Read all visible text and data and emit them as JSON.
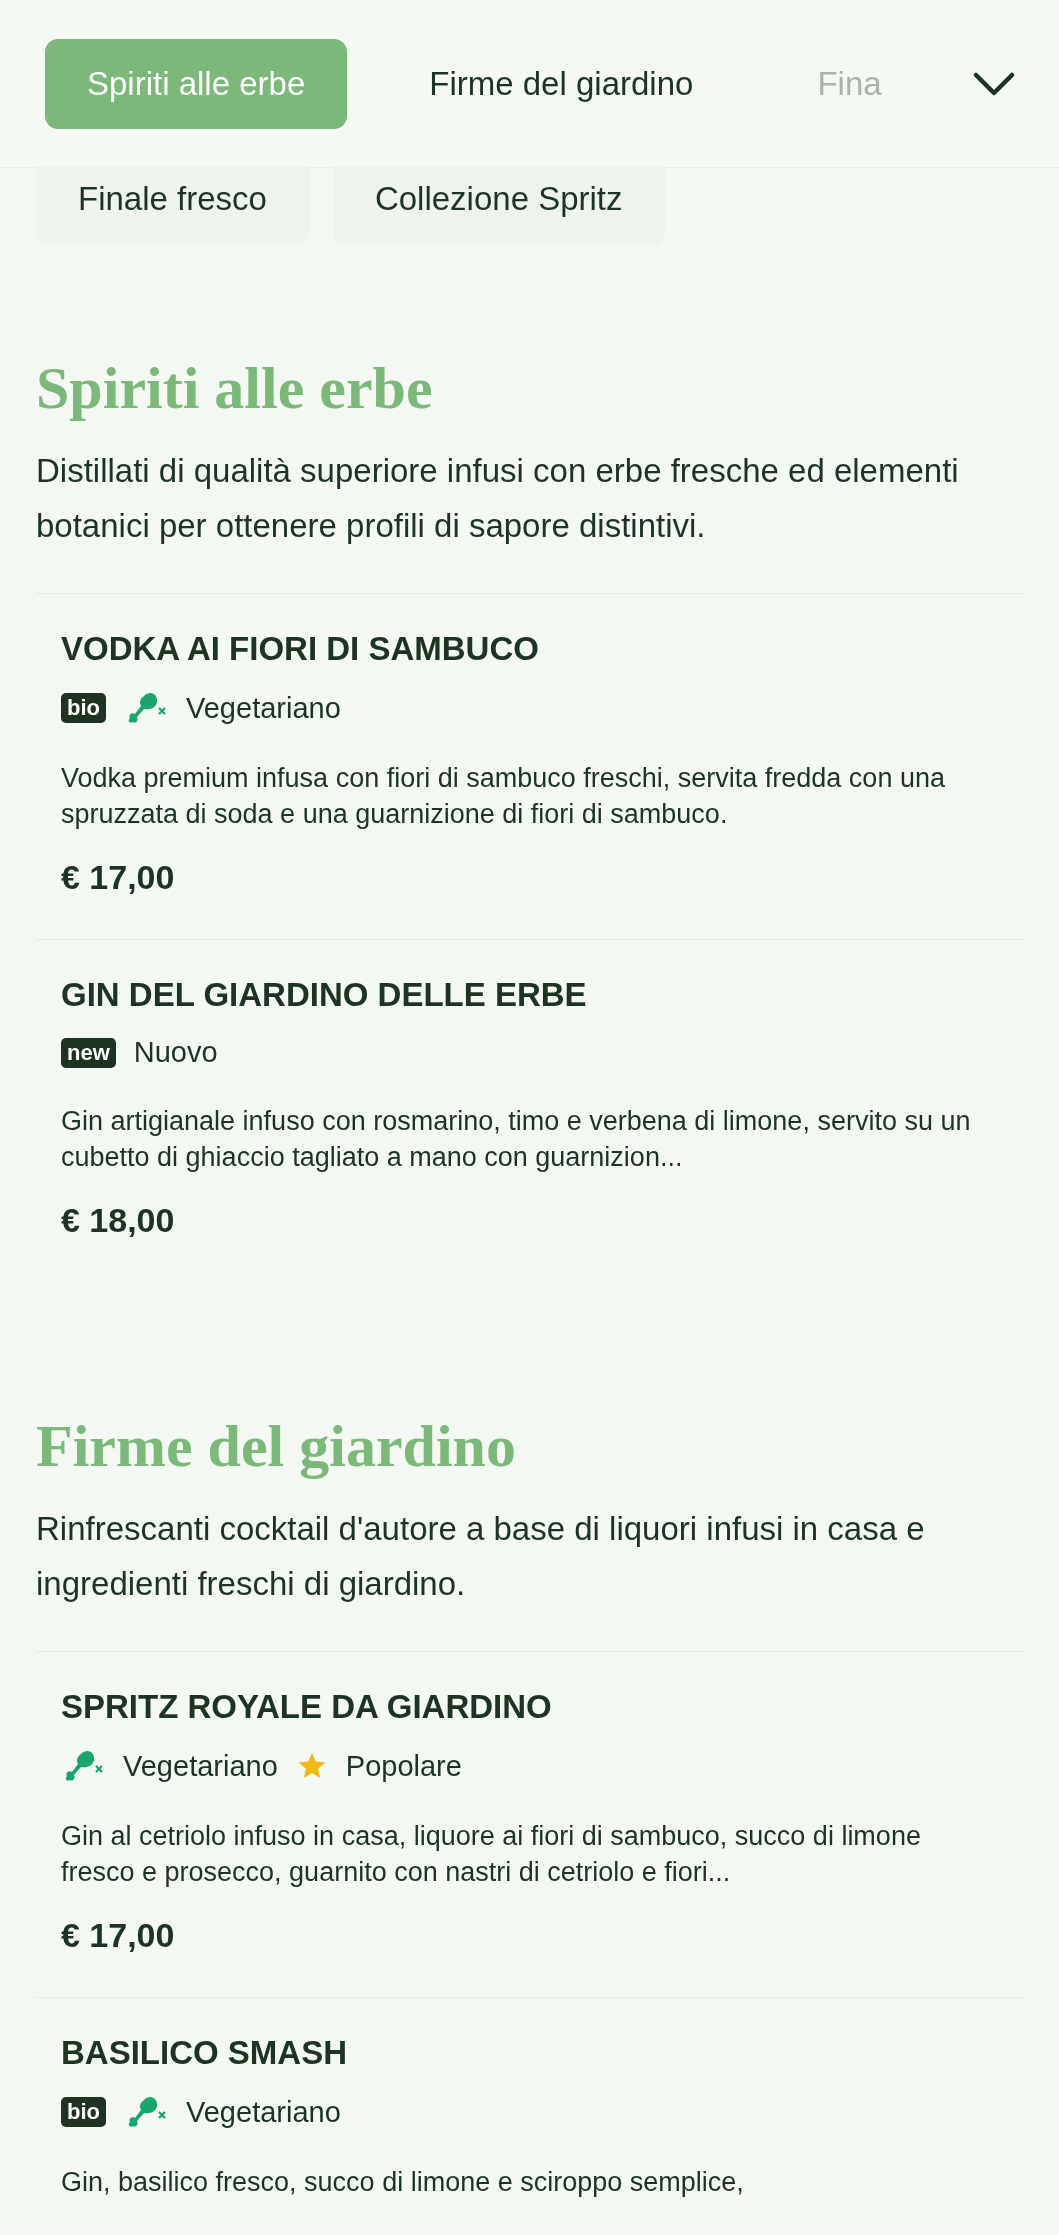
{
  "category_tabs": [
    {
      "label": "Spiriti alle erbe",
      "selected": true
    },
    {
      "label": "Firme del giardino",
      "selected": false
    },
    {
      "label": "Fina",
      "selected": false
    }
  ],
  "category_chips": [
    {
      "label": "Finale fresco"
    },
    {
      "label": "Collezione Spritz"
    }
  ],
  "sections": [
    {
      "title": "Spiriti alle erbe",
      "description": "Distillati di qualità superiore infusi con erbe fresche ed elementi botanici per ottenere profili di sapore distintivi.",
      "items": [
        {
          "name": "VODKA AI FIORI DI SAMBUCO",
          "tags": [
            {
              "kind": "badge",
              "text": "bio"
            },
            {
              "kind": "vegetarian",
              "text": "Vegetariano"
            }
          ],
          "description": "Vodka premium infusa con fiori di sambuco freschi, servita fredda con una spruzzata di soda e una guarnizione di fiori di sambuco.",
          "price": "€ 17,00"
        },
        {
          "name": "GIN DEL GIARDINO DELLE ERBE",
          "tags": [
            {
              "kind": "badge",
              "text": "new"
            },
            {
              "kind": "plain",
              "text": "Nuovo"
            }
          ],
          "description": "Gin artigianale infuso con rosmarino, timo e verbena di limone, servito su un cubetto di ghiaccio tagliato a mano con guarnizion...",
          "price": "€ 18,00"
        }
      ]
    },
    {
      "title": "Firme del giardino",
      "description": "Rinfrescanti cocktail d'autore a base di liquori infusi in casa e ingredienti freschi di giardino.",
      "items": [
        {
          "name": "SPRITZ ROYALE DA GIARDINO",
          "tags": [
            {
              "kind": "vegetarian",
              "text": "Vegetariano"
            },
            {
              "kind": "popular",
              "text": "Popolare"
            }
          ],
          "description": "Gin al cetriolo infuso in casa, liquore ai fiori di sambuco, succo di limone fresco e prosecco, guarnito con nastri di cetriolo e fiori...",
          "price": "€ 17,00"
        },
        {
          "name": "BASILICO SMASH",
          "tags": [
            {
              "kind": "badge",
              "text": "bio"
            },
            {
              "kind": "vegetarian",
              "text": "Vegetariano"
            }
          ],
          "description": "Gin, basilico fresco, succo di limone e sciroppo semplice,"
        }
      ]
    }
  ]
}
